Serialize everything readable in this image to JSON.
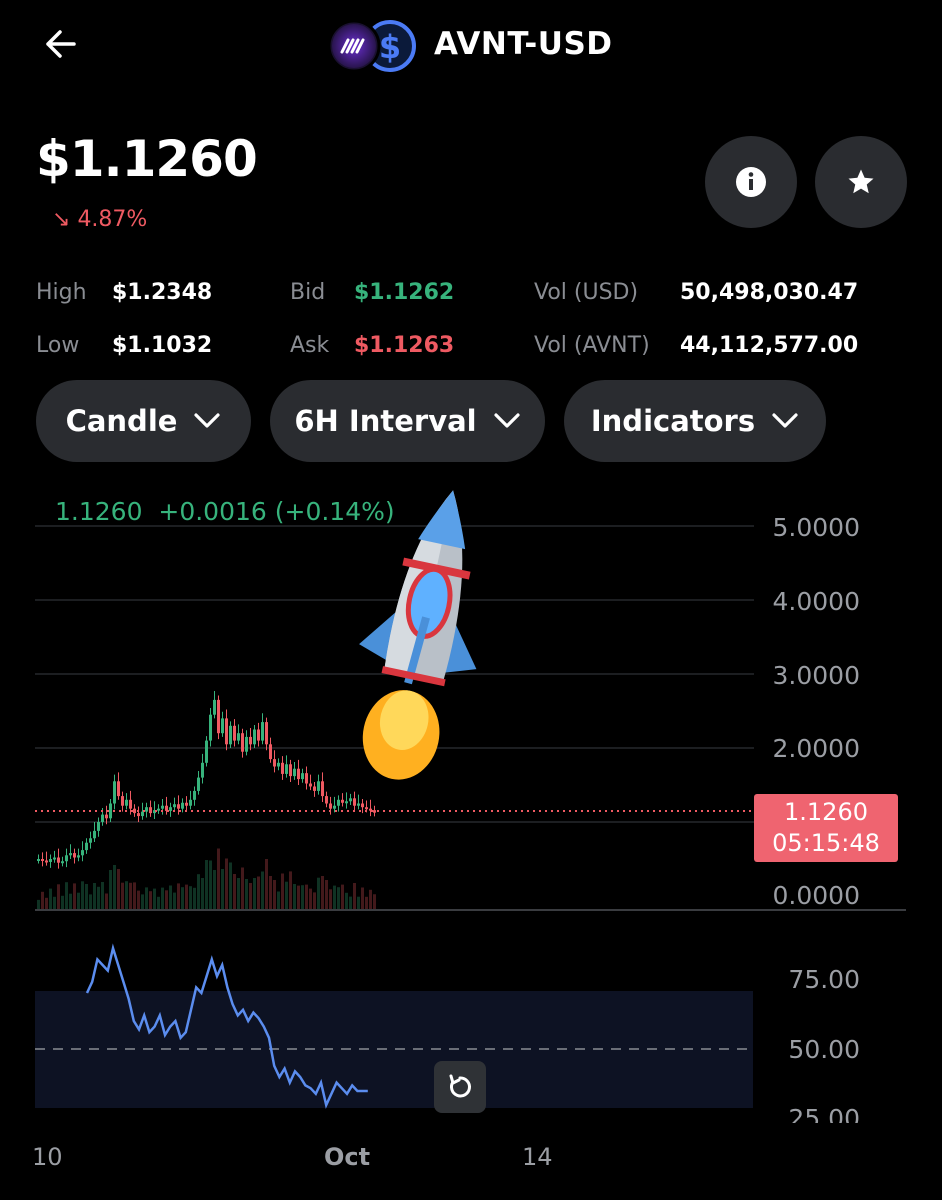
{
  "header": {
    "title": "AVNT-USD",
    "back_icon": "arrow-left-icon",
    "coin_icon": "avnt-logo-icon",
    "quote_icon": "usd-coin-icon"
  },
  "quote": {
    "price": "$1.1260",
    "change": "4.87%",
    "change_direction": "down",
    "change_color": "#ef5a62"
  },
  "actions": {
    "info_icon": "info-icon",
    "favorite_icon": "star-icon"
  },
  "stats": {
    "high_label": "High",
    "high_value": "$1.2348",
    "low_label": "Low",
    "low_value": "$1.1032",
    "bid_label": "Bid",
    "bid_value": "$1.1262",
    "ask_label": "Ask",
    "ask_value": "$1.1263",
    "vol_usd_label": "Vol (USD)",
    "vol_usd_value": "50,498,030.47",
    "vol_avnt_label": "Vol (AVNT)",
    "vol_avnt_value": "44,112,577.00"
  },
  "controls": {
    "chart_type": "Candle",
    "interval": "6H Interval",
    "indicators": "Indicators"
  },
  "chart": {
    "ohlc_summary": "1.1260  +0.0016 (+0.14%)",
    "price_axis": [
      "5.0000",
      "4.0000",
      "3.0000",
      "2.0000",
      "0.0000"
    ],
    "last_price_tag": "1.1260",
    "countdown": "05:15:48",
    "rsi_axis": [
      "75.00",
      "50.00",
      "25.00"
    ],
    "x_axis": [
      "10",
      "Oct",
      "14"
    ],
    "overlay_icon": "rocket-emoji-icon",
    "reset_icon": "reset-zoom-icon",
    "up_color": "#37b37c",
    "down_color": "#ef5a62",
    "rsi_color": "#5b8def"
  },
  "chart_data": [
    {
      "type": "candlestick",
      "title": "",
      "ylim": [
        0,
        5
      ],
      "series": [
        {
          "name": "",
          "values": [
            0.5,
            0.48,
            0.46,
            0.5,
            0.52,
            0.45,
            0.47,
            0.55,
            0.58,
            0.52,
            0.55,
            0.62,
            0.72,
            0.78,
            0.88,
            1.0,
            1.1,
            1.05,
            1.25,
            1.55,
            1.35,
            1.22,
            1.3,
            1.18,
            1.12,
            1.08,
            1.14,
            1.2,
            1.12,
            1.16,
            1.18,
            1.22,
            1.15,
            1.2,
            1.24,
            1.18,
            1.26,
            1.22,
            1.3,
            1.42,
            1.6,
            1.8,
            2.1,
            2.45,
            2.65,
            2.2,
            2.4,
            2.05,
            2.3,
            2.1,
            2.2,
            1.95,
            2.15,
            2.05,
            2.25,
            2.1,
            2.35,
            2.05,
            1.85,
            1.75,
            1.8,
            1.65,
            1.78,
            1.62,
            1.72,
            1.58,
            1.66,
            1.52,
            1.48,
            1.42,
            1.55,
            1.35,
            1.25,
            1.18,
            1.22,
            1.3,
            1.26,
            1.28,
            1.32,
            1.22,
            1.25,
            1.2,
            1.18,
            1.16,
            1.126
          ]
        }
      ]
    },
    {
      "type": "line",
      "title": "",
      "ylim": [
        25,
        90
      ],
      "series": [
        {
          "name": "",
          "values": [
            70,
            74,
            82,
            80,
            78,
            86,
            80,
            74,
            68,
            60,
            57,
            62,
            56,
            58,
            62,
            55,
            58,
            60,
            54,
            56,
            64,
            72,
            70,
            76,
            82,
            76,
            80,
            72,
            66,
            62,
            64,
            60,
            63,
            61,
            58,
            54,
            44,
            40,
            43,
            38,
            42,
            40,
            37,
            36,
            34,
            38,
            30,
            34,
            38,
            36,
            34,
            37,
            35,
            35,
            35
          ]
        }
      ]
    }
  ]
}
